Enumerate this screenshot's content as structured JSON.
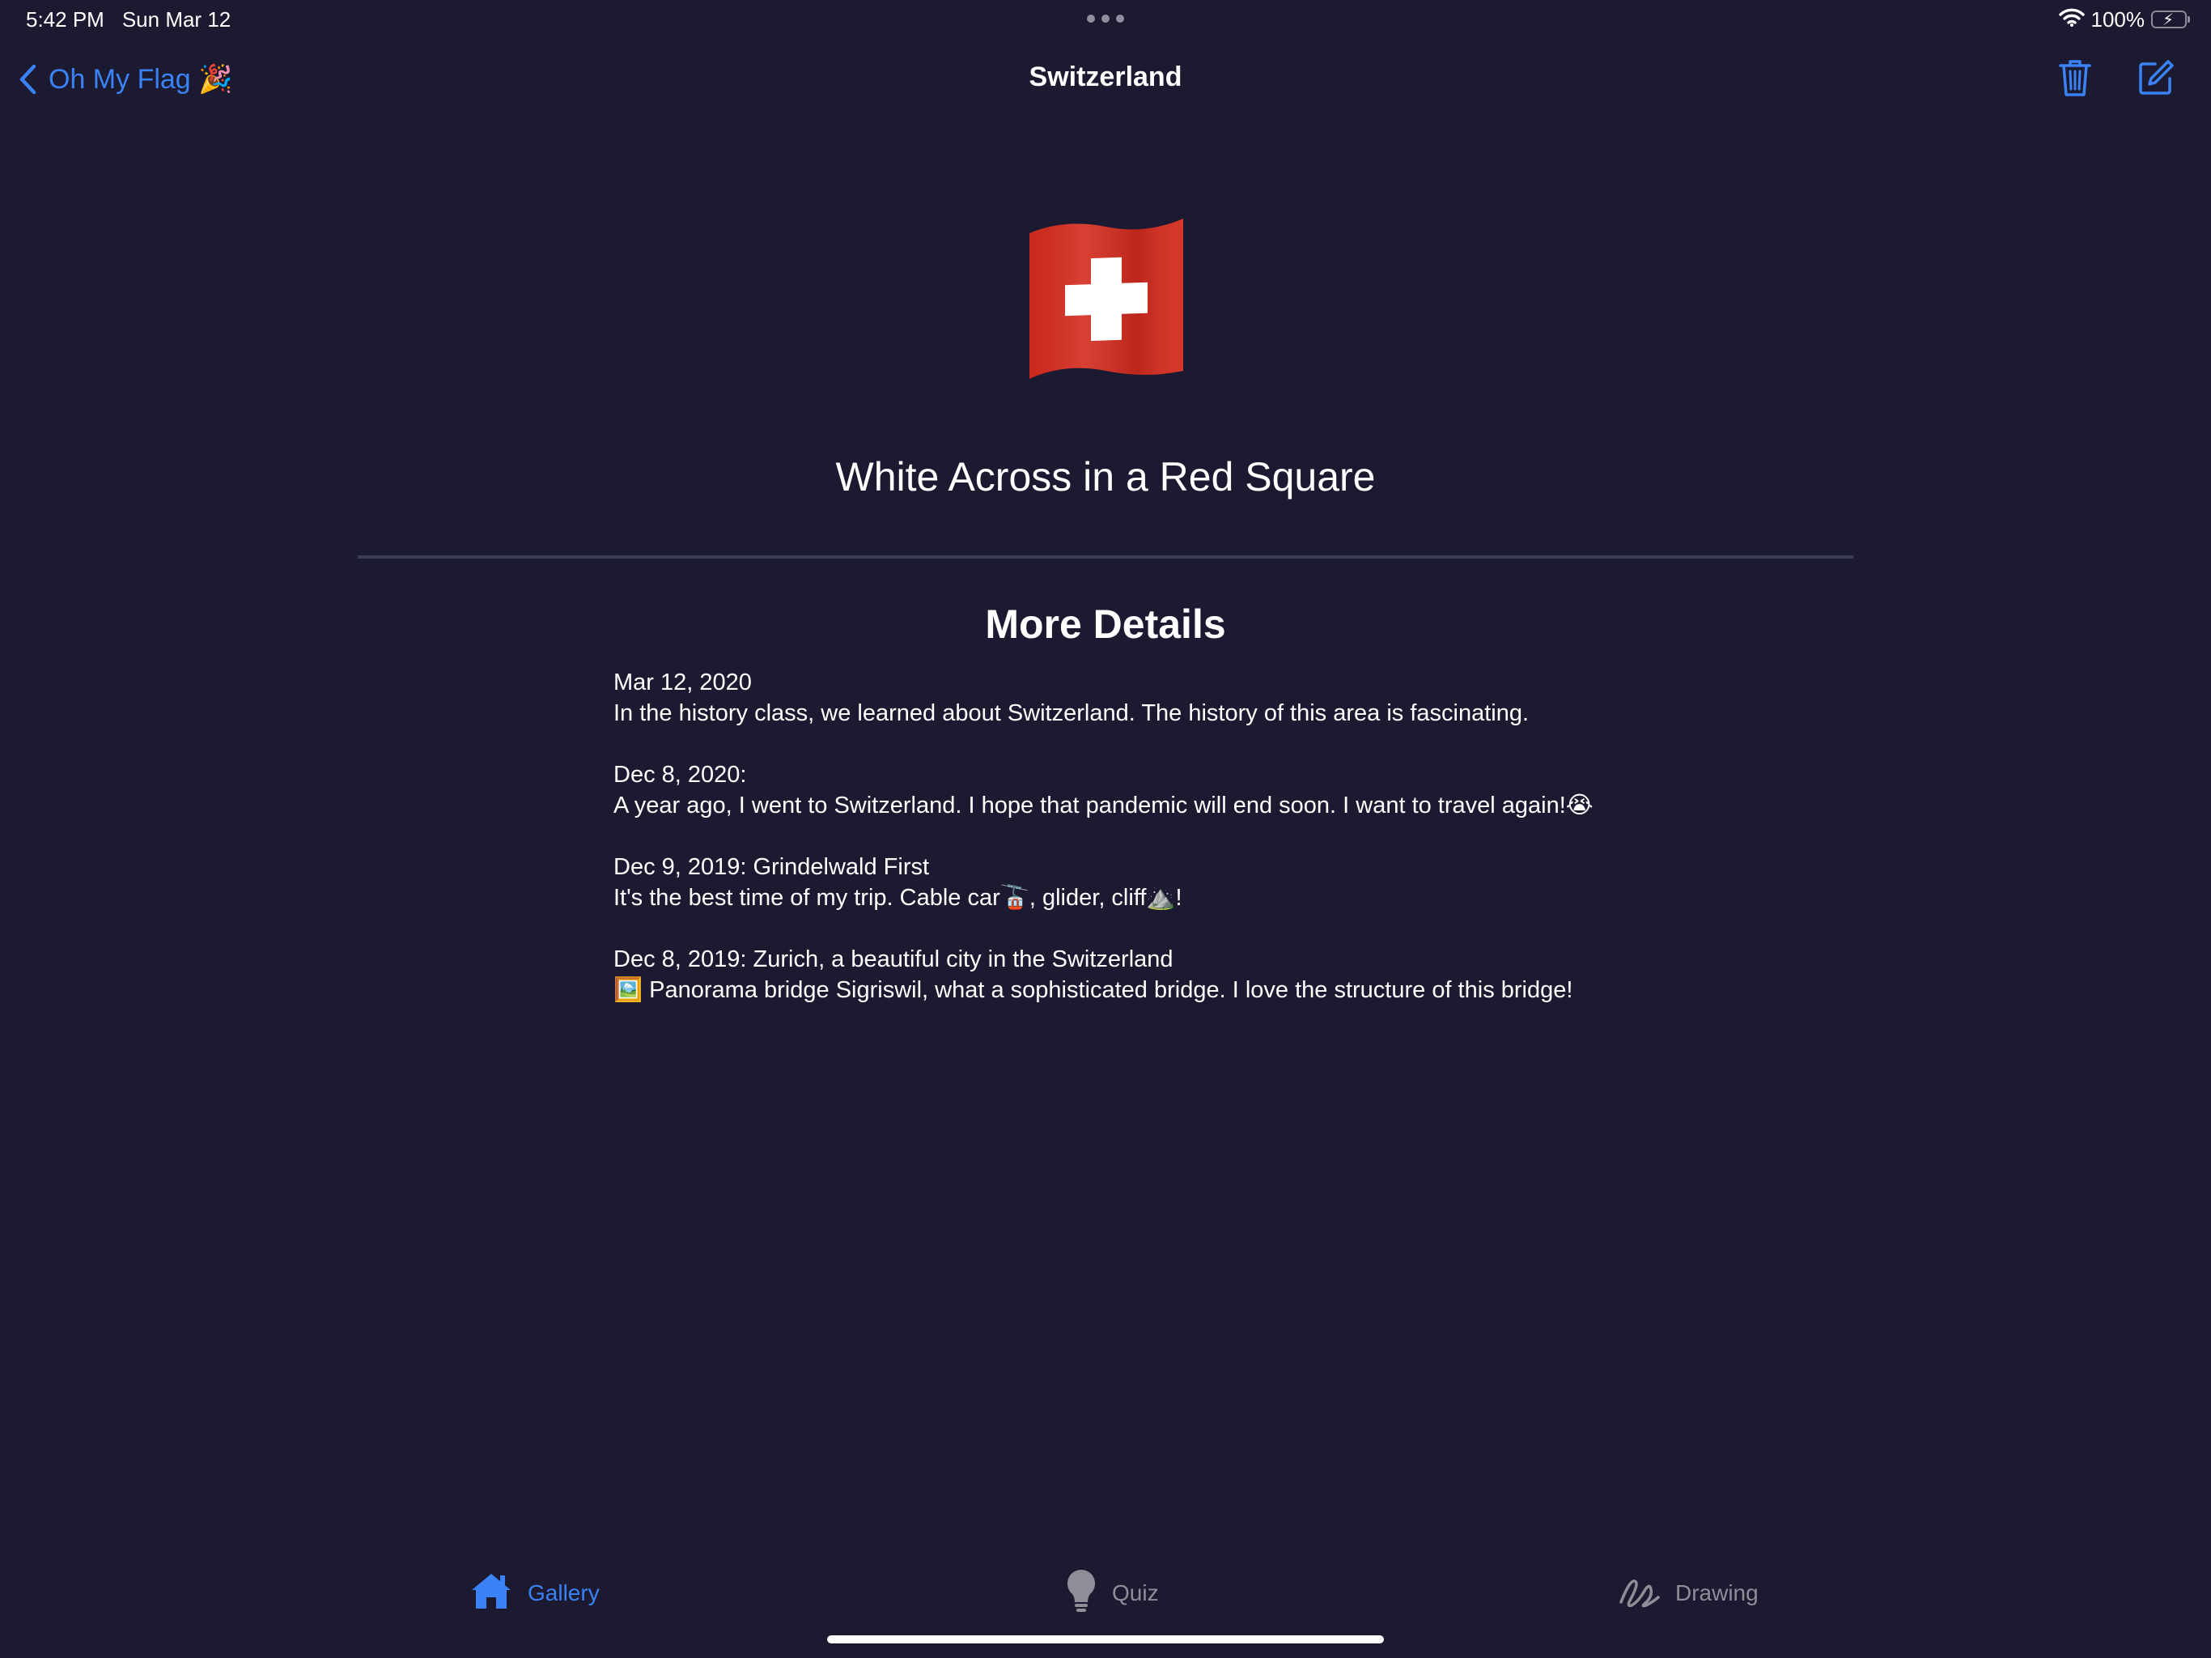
{
  "status_bar": {
    "time": "5:42 PM",
    "date": "Sun Mar 12",
    "battery": "100%",
    "battery_level": 1.0
  },
  "nav": {
    "back_label": "Oh My Flag 🎉",
    "title": "Switzerland",
    "trash_icon": "trash-icon",
    "edit_icon": "compose-icon"
  },
  "flag": {
    "country": "Switzerland",
    "description": "White Across in a Red Square",
    "colors": {
      "red": "#d52b1e",
      "white": "#ffffff"
    }
  },
  "details": {
    "heading": "More Details",
    "entries": [
      {
        "line1": "Mar 12, 2020",
        "line2": "In the history class, we learned about Switzerland. The history of this area is fascinating."
      },
      {
        "line1": "Dec 8, 2020:",
        "line2": "A year ago, I went to Switzerland. I hope that pandemic will end soon. I want to travel again!😭"
      },
      {
        "line1": "Dec 9, 2019: Grindelwald First",
        "line2": "It's the best time of my trip. Cable car🚡, glider, cliff⛰️!"
      },
      {
        "line1": "Dec 8, 2019: Zurich, a beautiful city in the Switzerland",
        "line2": "🖼️ Panorama bridge Sigriswil, what a sophisticated bridge. I love the structure of this bridge!"
      }
    ]
  },
  "tabs": [
    {
      "label": "Gallery",
      "icon": "house-icon",
      "active": true
    },
    {
      "label": "Quiz",
      "icon": "lightbulb-icon",
      "active": false
    },
    {
      "label": "Drawing",
      "icon": "scribble-icon",
      "active": false
    }
  ],
  "colors": {
    "background": "#1b1a30",
    "accent": "#3b82f6",
    "inactive": "#8e8e98"
  }
}
